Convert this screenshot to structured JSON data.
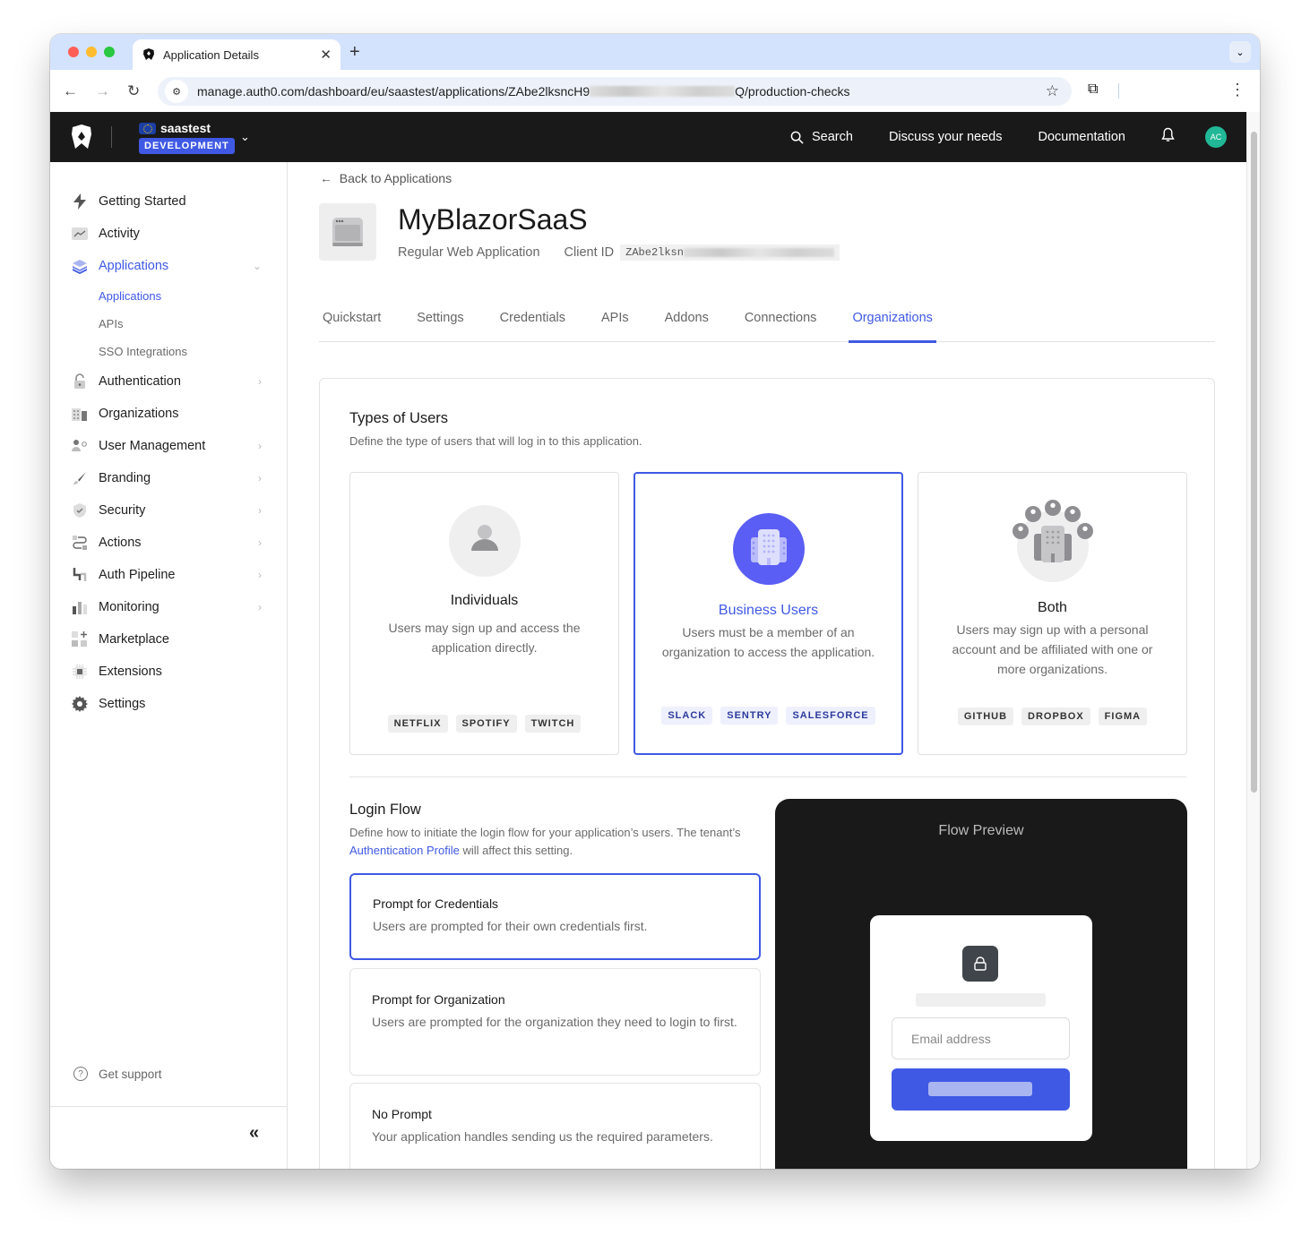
{
  "browser": {
    "tab_title": "Application Details",
    "url_prefix": "manage.auth0.com/dashboard/eu/saastest/applications/ZAbe2lksncH9",
    "url_suffix": "Q/production-checks"
  },
  "topbar": {
    "tenant_name": "saastest",
    "environment_badge": "DEVELOPMENT",
    "search_label": "Search",
    "discuss_label": "Discuss your needs",
    "docs_label": "Documentation",
    "avatar_initials": "AC"
  },
  "sidebar": {
    "items": [
      {
        "label": "Getting Started",
        "icon": "lightning-icon"
      },
      {
        "label": "Activity",
        "icon": "activity-chart-icon"
      },
      {
        "label": "Applications",
        "icon": "layers-icon",
        "active": true,
        "expanded": true
      },
      {
        "label": "Authentication",
        "icon": "lock-icon",
        "chevron": true
      },
      {
        "label": "Organizations",
        "icon": "building-icon"
      },
      {
        "label": "User Management",
        "icon": "users-icon",
        "chevron": true
      },
      {
        "label": "Branding",
        "icon": "brush-icon",
        "chevron": true
      },
      {
        "label": "Security",
        "icon": "shield-icon",
        "chevron": true
      },
      {
        "label": "Actions",
        "icon": "actions-flow-icon",
        "chevron": true
      },
      {
        "label": "Auth Pipeline",
        "icon": "pipeline-icon",
        "chevron": true
      },
      {
        "label": "Monitoring",
        "icon": "bar-chart-icon",
        "chevron": true
      },
      {
        "label": "Marketplace",
        "icon": "marketplace-icon"
      },
      {
        "label": "Extensions",
        "icon": "chip-icon"
      },
      {
        "label": "Settings",
        "icon": "gear-icon"
      }
    ],
    "sub_items": [
      "Applications",
      "APIs",
      "SSO Integrations"
    ],
    "support_label": "Get support"
  },
  "main": {
    "back_label": "Back to Applications",
    "app_name": "MyBlazorSaaS",
    "app_type": "Regular Web Application",
    "client_id_label": "Client ID",
    "client_id_visible": "ZAbe2lksn",
    "tabs": [
      "Quickstart",
      "Settings",
      "Credentials",
      "APIs",
      "Addons",
      "Connections",
      "Organizations"
    ],
    "active_tab": "Organizations",
    "types": {
      "title": "Types of Users",
      "description": "Define the type of users that will log in to this application.",
      "cards": [
        {
          "title": "Individuals",
          "description": "Users may sign up and access the application directly.",
          "tags": [
            "NETFLIX",
            "SPOTIFY",
            "TWITCH"
          ]
        },
        {
          "title": "Business Users",
          "description": "Users must be a member of an organization to access the application.",
          "tags": [
            "SLACK",
            "SENTRY",
            "SALESFORCE"
          ],
          "selected": true
        },
        {
          "title": "Both",
          "description": "Users may sign up with a personal account and be affiliated with one or more organizations.",
          "tags": [
            "GITHUB",
            "DROPBOX",
            "FIGMA"
          ]
        }
      ]
    },
    "login_flow": {
      "title": "Login Flow",
      "description_before": "Define how to initiate the login flow for your application’s users. The tenant’s ",
      "link_text": "Authentication Profile",
      "description_after": " will affect this setting.",
      "options": [
        {
          "title": "Prompt for Credentials",
          "description": "Users are prompted for their own credentials first.",
          "selected": true
        },
        {
          "title": "Prompt for Organization",
          "description": "Users are prompted for the organization they need to login to first."
        },
        {
          "title": "No Prompt",
          "description": "Your application handles sending us the required parameters."
        }
      ]
    },
    "preview": {
      "title": "Flow Preview",
      "email_placeholder": "Email address"
    }
  },
  "colors": {
    "accent": "#3f59e4",
    "topbar": "#191919",
    "avatar": "#20b896"
  }
}
